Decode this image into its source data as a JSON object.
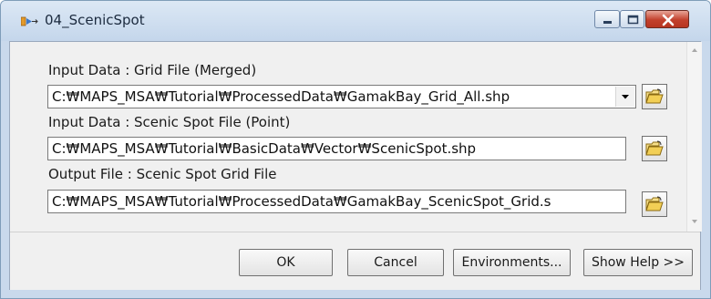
{
  "window": {
    "title": "04_ScenicSpot"
  },
  "fields": [
    {
      "label": "Input Data : Grid File (Merged)",
      "value": "C:₩MAPS_MSA₩Tutorial₩ProcessedData₩GamakBay_Grid_All.shp",
      "has_dropdown": true
    },
    {
      "label": "Input Data : Scenic Spot File (Point)",
      "value": "C:₩MAPS_MSA₩Tutorial₩BasicData₩Vector₩ScenicSpot.shp",
      "has_dropdown": false
    },
    {
      "label": "Output File : Scenic Spot Grid File",
      "value": "C:₩MAPS_MSA₩Tutorial₩ProcessedData₩GamakBay_ScenicSpot_Grid.s",
      "has_dropdown": false
    }
  ],
  "buttons": {
    "ok": "OK",
    "cancel": "Cancel",
    "environments": "Environments...",
    "show_help": "Show Help >>"
  },
  "icons": {
    "title": "model-tool-icon",
    "browse": "open-folder-icon",
    "dropdown": "chevron-down-icon"
  },
  "colors": {
    "close_button": "#c2402c",
    "titlebar": "#c9d9ec",
    "dialog_background": "#f0f0f0"
  }
}
